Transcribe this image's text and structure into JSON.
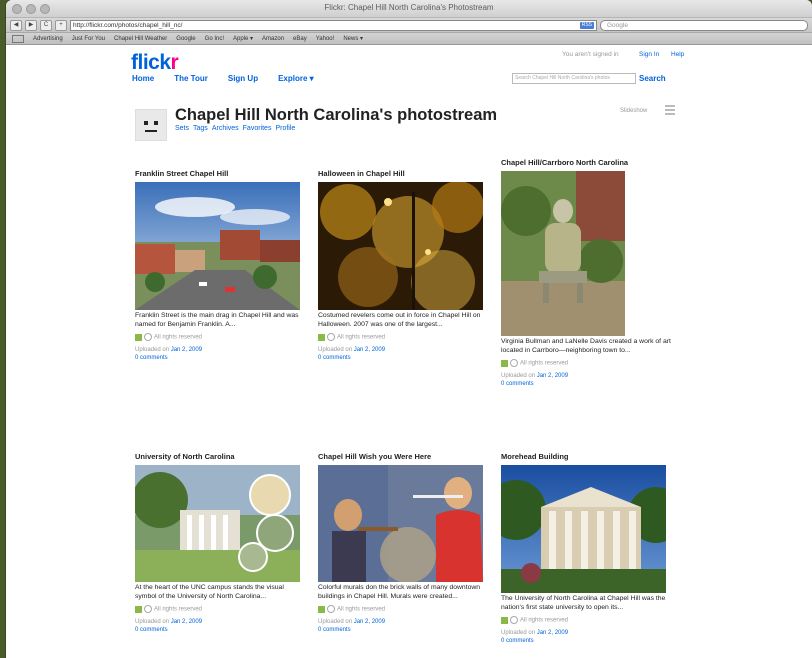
{
  "window": {
    "title": "Flickr: Chapel Hill North Carolina's Photostream",
    "url": "http://flickr.com/photos/chapel_hill_nc/",
    "rss": "RSS",
    "search_placeholder": "Google"
  },
  "toolbar": {
    "back": "◀",
    "forward": "▶",
    "reload": "C",
    "add": "+"
  },
  "bookmarks": [
    "Advertising",
    "Just For You",
    "Chapel Hill Weather",
    "Google",
    "Go Inc!",
    "Apple ▾",
    "Amazon",
    "eBay",
    "Yahoo!",
    "News ▾"
  ],
  "flickr": {
    "logo_a": "flick",
    "logo_b": "r",
    "signed_in": "You aren't signed in",
    "sign_in": "Sign In",
    "help": "Help",
    "nav": [
      "Home",
      "The Tour",
      "Sign Up",
      "Explore ▾"
    ],
    "search_placeholder": "Search Chapel Hill North Carolina's photos",
    "search_button": "Search"
  },
  "stream": {
    "title": "Chapel Hill North Carolina's photostream",
    "subnav": [
      "Sets",
      "Tags",
      "Archives",
      "Favorites",
      "Profile"
    ],
    "slideshow": "Slideshow"
  },
  "photos": [
    {
      "title": "Franklin Street Chapel Hill",
      "desc": "Franklin Street is the main drag in Chapel Hill and was named for Benjamin Franklin. A...",
      "rights": "All rights reserved",
      "uploaded": "Uploaded on",
      "date": "Jan 2, 2009",
      "comments": "0 comments"
    },
    {
      "title": "Halloween in Chapel Hill",
      "desc": "Costumed revelers come out in force in Chapel Hill on Halloween. 2007 was one of the largest...",
      "rights": "All rights reserved",
      "uploaded": "Uploaded on",
      "date": "Jan 2, 2009",
      "comments": "0 comments"
    },
    {
      "title": "Chapel Hill/Carrboro North Carolina",
      "desc": "Virginia Bullman and LaNelle Davis created a work of art located in Carrboro—neighboring town to...",
      "rights": "All rights reserved",
      "uploaded": "Uploaded on",
      "date": "Jan 2, 2009",
      "comments": "0 comments"
    },
    {
      "title": "University of North Carolina",
      "desc": "At the heart of the UNC campus stands the visual symbol of the University of North Carolina...",
      "rights": "All rights reserved",
      "uploaded": "Uploaded on",
      "date": "Jan 2, 2009",
      "comments": "0 comments"
    },
    {
      "title": "Chapel Hill Wish you Were Here",
      "desc": "Colorful murals don the brick walls of many downtown buildings in Chapel Hill. Murals were created...",
      "rights": "All rights reserved",
      "uploaded": "Uploaded on",
      "date": "Jan 2, 2009",
      "comments": "0 comments"
    },
    {
      "title": "Morehead Building",
      "desc": "The University of North Carolina at Chapel Hill was the nation's first state university to open its...",
      "rights": "All rights reserved",
      "uploaded": "Uploaded on",
      "date": "Jan 2, 2009",
      "comments": "0 comments"
    }
  ]
}
